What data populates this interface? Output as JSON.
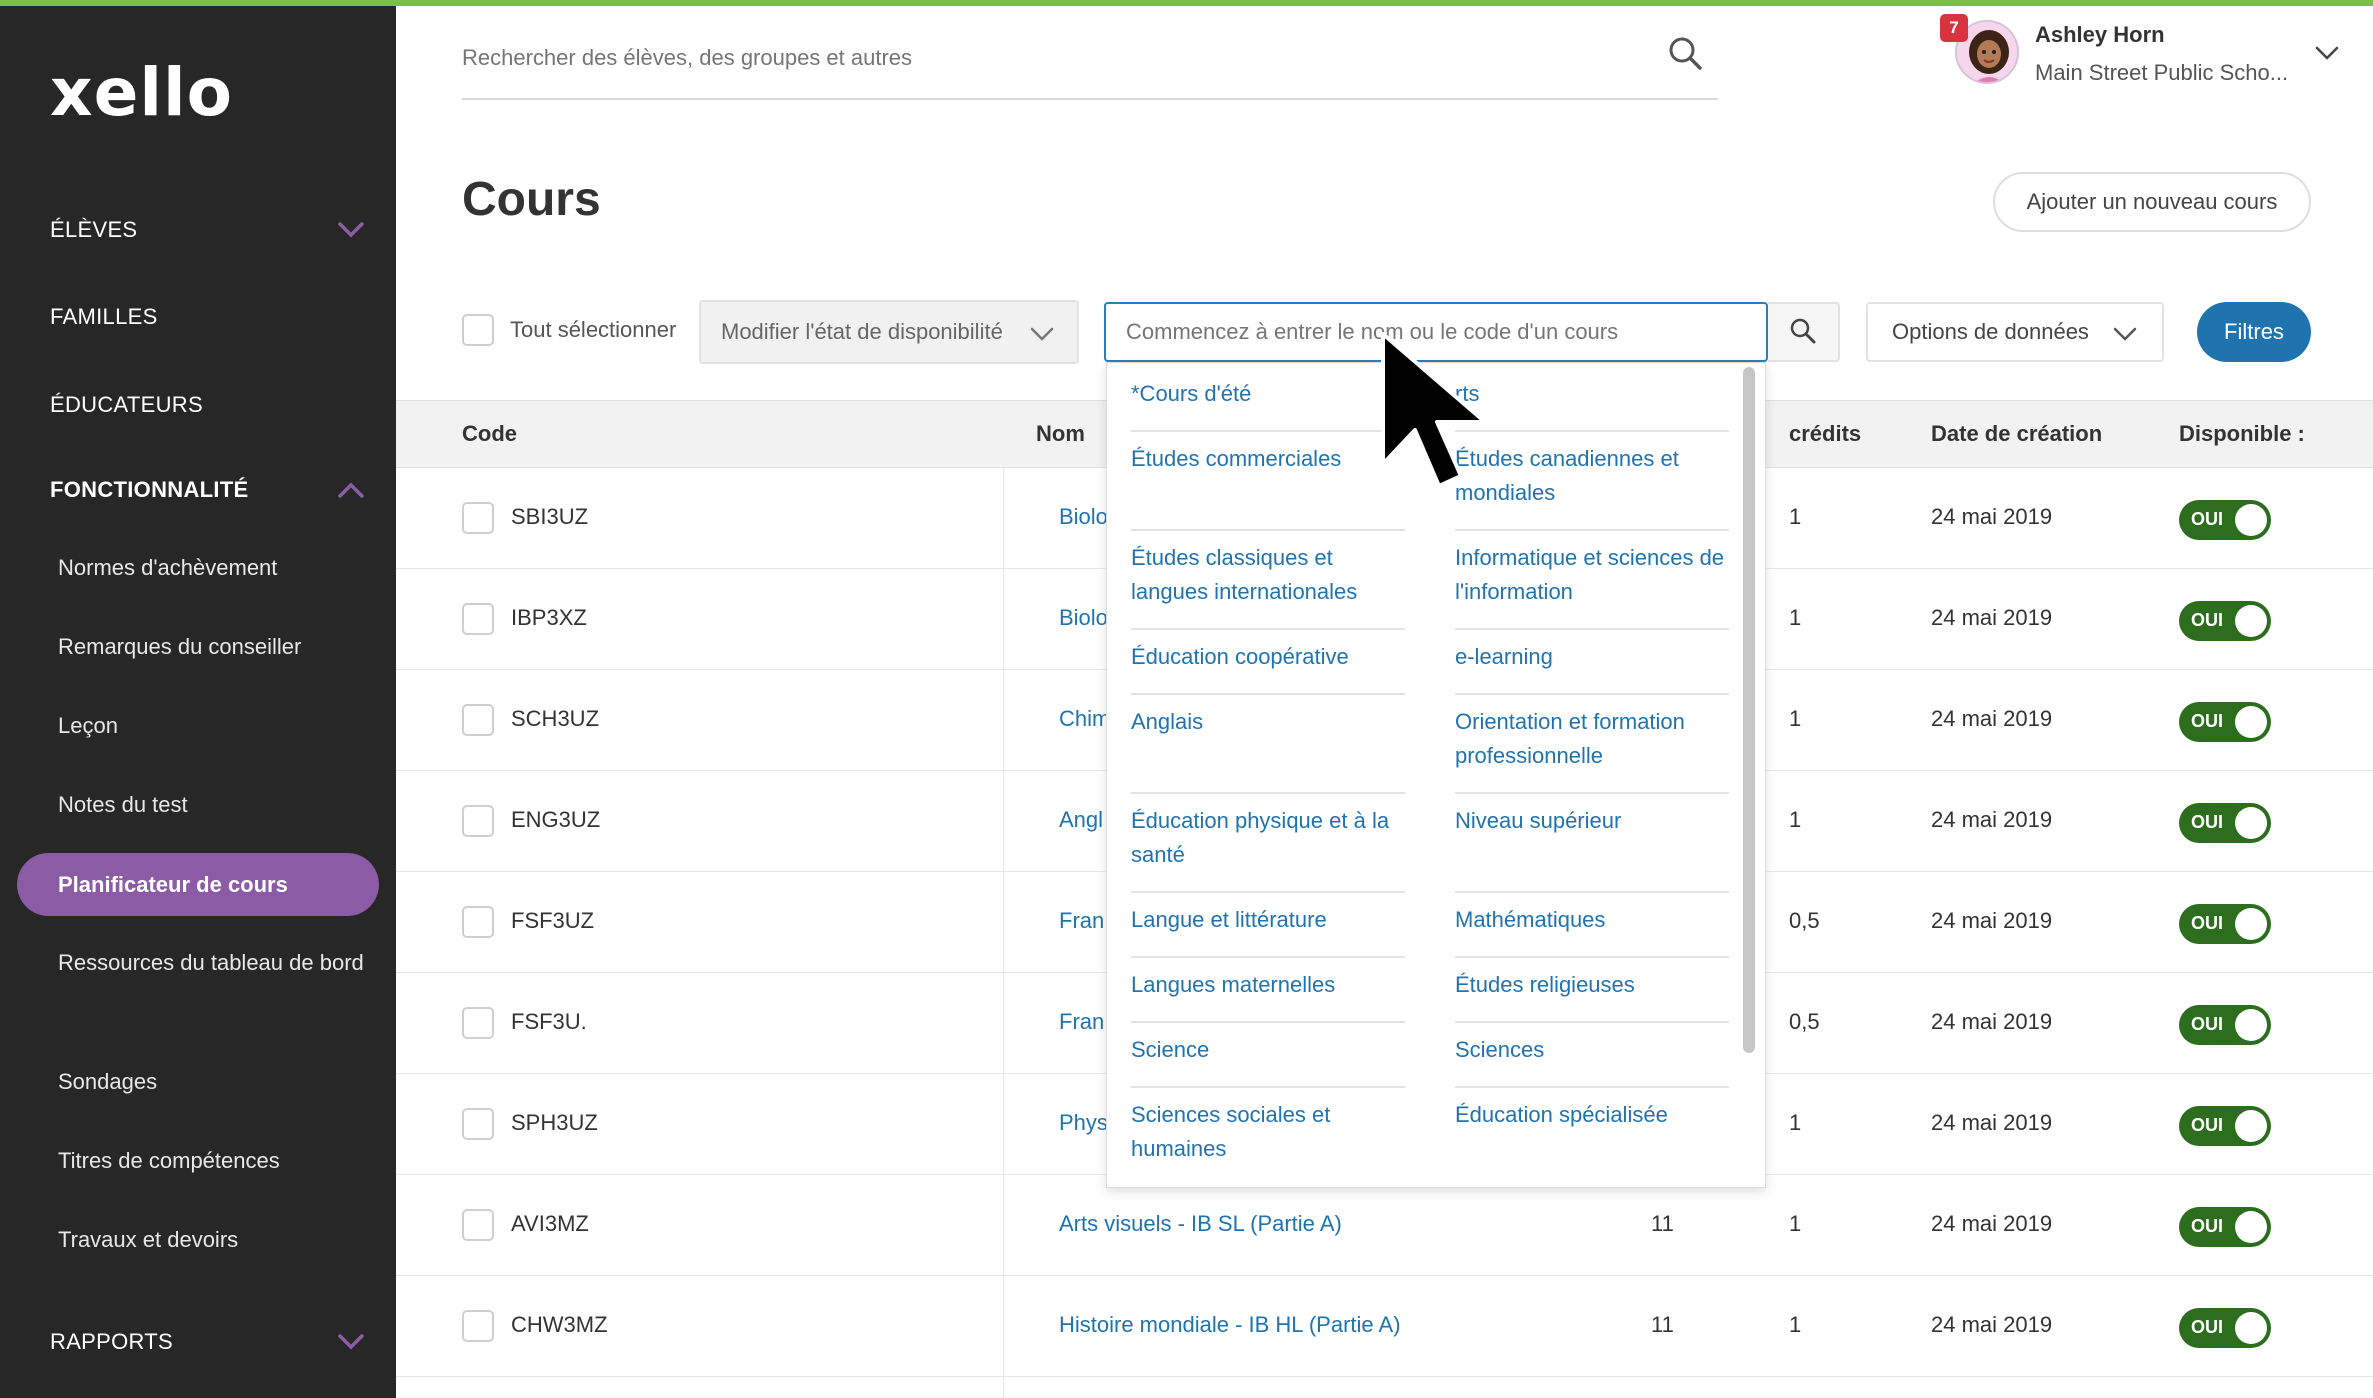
{
  "app": {
    "logo_text": "xello"
  },
  "sidebar": {
    "top_items": [
      {
        "label": "ÉLÈVES",
        "expanded": false
      },
      {
        "label": "FAMILLES"
      },
      {
        "label": "ÉDUCATEURS"
      },
      {
        "label": "FONCTIONNALITÉ",
        "expanded": true
      },
      {
        "label": "RAPPORTS",
        "expanded": false
      }
    ],
    "sub_items": [
      {
        "label": "Normes d'achèvement"
      },
      {
        "label": "Remarques du conseiller"
      },
      {
        "label": "Leçon"
      },
      {
        "label": "Notes du test"
      },
      {
        "label": "Planificateur de cours",
        "active": true
      },
      {
        "label": "Ressources du tableau de bord"
      },
      {
        "label": "Sondages"
      },
      {
        "label": "Titres de compétences"
      },
      {
        "label": "Travaux et devoirs"
      }
    ]
  },
  "header": {
    "search_placeholder": "Rechercher des élèves, des groupes et autres",
    "user": {
      "name": "Ashley Horn",
      "school": "Main Street Public Scho...",
      "notifications": "7"
    }
  },
  "page": {
    "title": "Cours",
    "add_button": "Ajouter un nouveau cours"
  },
  "toolbar": {
    "select_all": "Tout sélectionner",
    "availability_dropdown": "Modifier l'état de disponibilité",
    "course_search_placeholder": "Commencez à entrer le nom ou le code d'un cours",
    "data_options": "Options de données",
    "filters": "Filtres"
  },
  "table": {
    "headers": {
      "code": "Code",
      "name": "Nom",
      "credits": "crédits",
      "created": "Date de création",
      "available": "Disponible :"
    },
    "rows": [
      {
        "code": "SBI3UZ",
        "name": "Biolo",
        "grade": "",
        "credits": "1",
        "created": "24 mai 2019",
        "available": "OUI"
      },
      {
        "code": "IBP3XZ",
        "name": "Biolo",
        "grade": "",
        "credits": "1",
        "created": "24 mai 2019",
        "available": "OUI"
      },
      {
        "code": "SCH3UZ",
        "name": "Chim",
        "grade": "",
        "credits": "1",
        "created": "24 mai 2019",
        "available": "OUI"
      },
      {
        "code": "ENG3UZ",
        "name": "Angl",
        "grade": "",
        "credits": "1",
        "created": "24 mai 2019",
        "available": "OUI"
      },
      {
        "code": "FSF3UZ",
        "name": "Fran",
        "grade": "",
        "credits": "0,5",
        "created": "24 mai 2019",
        "available": "OUI"
      },
      {
        "code": "FSF3U.",
        "name": "Fran",
        "grade": "",
        "credits": "0,5",
        "created": "24 mai 2019",
        "available": "OUI"
      },
      {
        "code": "SPH3UZ",
        "name": "Phys",
        "grade": "",
        "credits": "1",
        "created": "24 mai 2019",
        "available": "OUI"
      },
      {
        "code": "AVI3MZ",
        "name": "Arts visuels - IB SL (Partie A)",
        "grade": "11",
        "credits": "1",
        "created": "24 mai 2019",
        "available": "OUI"
      },
      {
        "code": "CHW3MZ",
        "name": "Histoire mondiale - IB HL (Partie A)",
        "grade": "11",
        "credits": "1",
        "created": "24 mai 2019",
        "available": "OUI"
      }
    ]
  },
  "suggestions": {
    "left": [
      "*Cours d'été",
      "Études commerciales",
      "Études classiques et langues internationales",
      "Éducation coopérative",
      "Anglais",
      "Éducation physique et à la santé",
      "Langue et littérature",
      "Langues maternelles",
      "Science",
      "Sciences sociales et humaines"
    ],
    "right": [
      "rts",
      "Études canadiennes et mondiales",
      "Informatique et sciences de l'information",
      "e-learning",
      "Orientation et formation professionnelle",
      "Niveau supérieur",
      "Mathématiques",
      "Études religieuses",
      "Sciences",
      "Éducation spécialisée"
    ]
  },
  "colors": {
    "sidebar_bg": "#272727",
    "accent_purple": "#8b5ba6",
    "link_blue": "#1f74b0",
    "toggle_green": "#2c6e1e",
    "top_bar_green": "#7cc242"
  }
}
